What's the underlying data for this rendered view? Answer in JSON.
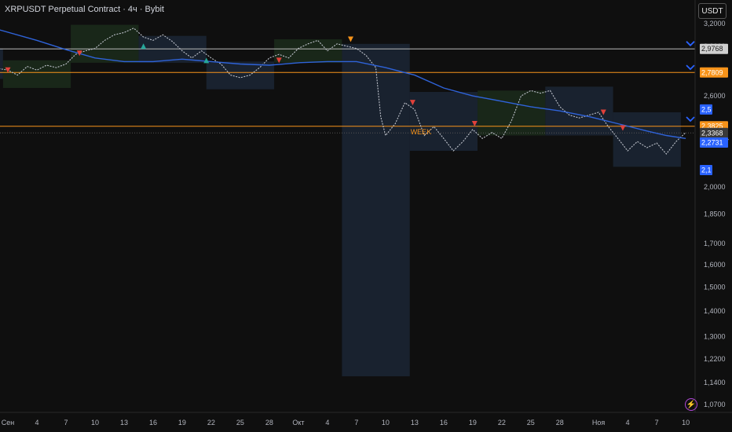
{
  "header": {
    "title": "XRPUSDT Perpetual Contract · 4ч · Bybit",
    "currency_button": "USDT"
  },
  "colors": {
    "background": "#0f0f0f",
    "price_line": "#bfc3cc",
    "ma_line": "#2f63d9",
    "orange_level": "#f7931a",
    "white_level": "#b9b9b9",
    "blue_box": "#1b2533",
    "green_box": "#1b2a1b",
    "tag_blue": "#2962ff",
    "tag_orange": "#f7931a",
    "tag_gray": "#3a3a3a"
  },
  "chart_data": {
    "type": "line",
    "title": "XRPUSDT Perpetual Contract · 4ч · Bybit",
    "y_axis": {
      "scale": "log",
      "ylim": [
        1.06,
        3.38
      ],
      "ticks": [
        "3,2000",
        "3,0000",
        "2,6000",
        "2,0000",
        "1,8500",
        "1,7000",
        "1,6000",
        "1,5000",
        "1,4000",
        "1,3000",
        "1,2200",
        "1,1400",
        "1,0700"
      ],
      "tick_values": [
        3.2,
        3.0,
        2.6,
        2.0,
        1.85,
        1.7,
        1.6,
        1.5,
        1.4,
        1.3,
        1.22,
        1.14,
        1.07
      ]
    },
    "x_axis": {
      "ticks": [
        "Сен",
        "4",
        "7",
        "10",
        "13",
        "16",
        "19",
        "22",
        "25",
        "28",
        "Окт",
        "4",
        "7",
        "10",
        "13",
        "16",
        "19",
        "22",
        "25",
        "28",
        "Ноя",
        "4",
        "7",
        "10"
      ],
      "tick_day_index": [
        0,
        3,
        6,
        9,
        12,
        15,
        18,
        21,
        24,
        27,
        30,
        33,
        36,
        39,
        42,
        45,
        48,
        51,
        54,
        57,
        61,
        64,
        67,
        70
      ]
    },
    "series": [
      {
        "kind": "price",
        "day_index": [
          -1.5,
          0,
          1,
          2,
          3,
          4,
          5,
          6,
          7,
          8,
          9,
          10,
          11,
          12,
          13,
          14,
          15,
          16,
          17,
          18,
          19,
          20,
          21,
          22,
          23,
          24,
          25,
          26,
          27,
          28,
          29,
          30,
          31,
          32,
          33,
          34,
          35,
          36,
          37,
          38,
          38.5,
          39,
          40,
          41,
          42,
          43,
          44,
          45,
          46,
          47,
          48,
          49,
          50,
          51,
          52,
          53,
          54,
          55,
          56,
          57,
          58,
          59,
          60,
          61,
          62,
          63,
          64,
          65,
          66,
          67,
          68,
          69,
          70
        ],
        "values": [
          2.82,
          2.8,
          2.76,
          2.83,
          2.8,
          2.84,
          2.82,
          2.85,
          2.93,
          2.96,
          2.98,
          3.05,
          3.1,
          3.12,
          3.16,
          3.08,
          3.05,
          3.1,
          3.04,
          2.96,
          2.9,
          2.96,
          2.9,
          2.85,
          2.76,
          2.74,
          2.76,
          2.82,
          2.9,
          2.93,
          2.9,
          2.98,
          3.02,
          3.05,
          2.96,
          3.02,
          3.0,
          2.98,
          2.92,
          2.82,
          2.45,
          2.32,
          2.4,
          2.55,
          2.5,
          2.32,
          2.38,
          2.3,
          2.22,
          2.28,
          2.36,
          2.3,
          2.34,
          2.3,
          2.42,
          2.6,
          2.64,
          2.62,
          2.64,
          2.52,
          2.46,
          2.44,
          2.46,
          2.48,
          2.38,
          2.3,
          2.22,
          2.28,
          2.24,
          2.27,
          2.2,
          2.28,
          2.34
        ]
      },
      {
        "kind": "moving-average",
        "day_index": [
          -1.5,
          3,
          6,
          9,
          12,
          15,
          18,
          21,
          24,
          27,
          30,
          33,
          36,
          39,
          42,
          45,
          48,
          51,
          54,
          57,
          60,
          63,
          66,
          68,
          70
        ],
        "values": [
          3.16,
          3.05,
          2.97,
          2.9,
          2.87,
          2.87,
          2.89,
          2.87,
          2.85,
          2.84,
          2.86,
          2.87,
          2.87,
          2.82,
          2.76,
          2.66,
          2.6,
          2.56,
          2.52,
          2.49,
          2.45,
          2.4,
          2.35,
          2.32,
          2.3
        ]
      }
    ],
    "horizontal_levels": [
      {
        "value": 2.9768,
        "label": "2,9768",
        "style": "white"
      },
      {
        "value": 2.7809,
        "label": "2,7809",
        "style": "orange"
      },
      {
        "value": 2.3825,
        "label": "2,3825",
        "style": "orange"
      }
    ],
    "price_tags": [
      {
        "value": 2.5,
        "label": "2,5",
        "style": "blue"
      },
      {
        "value": 2.3368,
        "label": "2,3368",
        "style": "gray",
        "sub": "03:14:37"
      },
      {
        "value": 2.2731,
        "label": "2,2731",
        "style": "blue"
      },
      {
        "value": 2.1,
        "label": "2,1",
        "style": "blue"
      }
    ],
    "range_boxes": [
      {
        "x0": -1.5,
        "x1": -0.5,
        "y0": 2.98,
        "y1": 2.73,
        "color": "blue"
      },
      {
        "x0": -0.5,
        "x1": 6.5,
        "y0": 2.88,
        "y1": 2.66,
        "color": "green"
      },
      {
        "x0": 6.5,
        "x1": 13.5,
        "y0": 3.19,
        "y1": 2.86,
        "color": "green"
      },
      {
        "x0": 13.5,
        "x1": 20.5,
        "y0": 3.09,
        "y1": 2.86,
        "color": "blue"
      },
      {
        "x0": 20.5,
        "x1": 27.5,
        "y0": 2.87,
        "y1": 2.65,
        "color": "blue"
      },
      {
        "x0": 27.5,
        "x1": 34.5,
        "y0": 3.06,
        "y1": 2.86,
        "color": "green"
      },
      {
        "x0": 34.5,
        "x1": 41.5,
        "y0": 3.02,
        "y1": 1.16,
        "color": "blue"
      },
      {
        "x0": 41.5,
        "x1": 48.5,
        "y0": 2.63,
        "y1": 2.22,
        "color": "blue"
      },
      {
        "x0": 48.5,
        "x1": 55.5,
        "y0": 2.64,
        "y1": 2.32,
        "color": "green"
      },
      {
        "x0": 55.5,
        "x1": 62.5,
        "y0": 2.67,
        "y1": 2.32,
        "color": "blue"
      },
      {
        "x0": 62.5,
        "x1": 69.5,
        "y0": 2.48,
        "y1": 2.12,
        "color": "blue"
      }
    ],
    "annotations": [
      {
        "text": "WEEK",
        "x": 41.5,
        "y": 2.38,
        "color": "orange"
      }
    ],
    "markers": [
      {
        "x": 0,
        "y": 2.8,
        "shape": "triangle-down",
        "color": "#e0413a"
      },
      {
        "x": 7.4,
        "y": 2.94,
        "shape": "triangle-down",
        "color": "#e0413a"
      },
      {
        "x": 14,
        "y": 3.0,
        "shape": "triangle-up",
        "color": "#26a69a"
      },
      {
        "x": 20.5,
        "y": 2.88,
        "shape": "triangle-up",
        "color": "#26a69a"
      },
      {
        "x": 28,
        "y": 2.88,
        "shape": "triangle-down",
        "color": "#e0413a"
      },
      {
        "x": 35.4,
        "y": 3.06,
        "shape": "triangle-down",
        "color": "#f7931a"
      },
      {
        "x": 41.8,
        "y": 2.55,
        "shape": "triangle-down",
        "color": "#e0413a"
      },
      {
        "x": 48.2,
        "y": 2.4,
        "shape": "triangle-down",
        "color": "#e0413a"
      },
      {
        "x": 61.5,
        "y": 2.48,
        "shape": "triangle-down",
        "color": "#e0413a"
      },
      {
        "x": 63.5,
        "y": 2.37,
        "shape": "triangle-down",
        "color": "#e0413a"
      }
    ],
    "chevrons": [
      {
        "value": 3.02,
        "color": "#2962ff"
      },
      {
        "value": 2.82,
        "color": "#2962ff"
      },
      {
        "value": 2.43,
        "color": "#2962ff"
      }
    ],
    "grid": false
  }
}
